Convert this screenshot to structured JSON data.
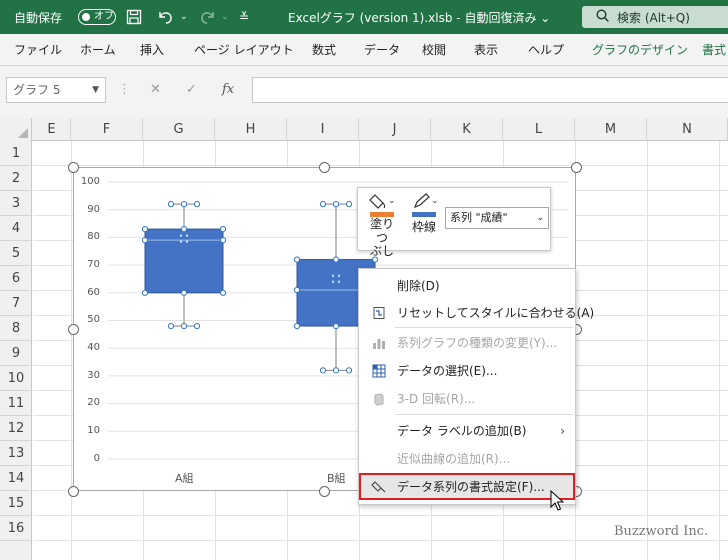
{
  "titlebar": {
    "autosave_label": "自動保存",
    "autosave_state": "オフ",
    "document_title": "Excelグラフ (version 1).xlsb  -  自動回復済み ⌄",
    "search_label": "検索 (Alt+Q)"
  },
  "ribbon": {
    "tabs": [
      "ファイル",
      "ホーム",
      "挿入",
      "ページ レイアウト",
      "数式",
      "データ",
      "校閲",
      "表示",
      "ヘルプ",
      "グラフのデザイン",
      "書式"
    ]
  },
  "formula_bar": {
    "name_box": "グラフ 5",
    "fx": "fx"
  },
  "grid": {
    "columns": [
      "E",
      "F",
      "G",
      "H",
      "I",
      "J",
      "K",
      "L",
      "M",
      "N"
    ],
    "rows": [
      "1",
      "2",
      "3",
      "4",
      "5",
      "6",
      "7",
      "8",
      "9",
      "10",
      "11",
      "12",
      "13",
      "14",
      "15",
      "16"
    ]
  },
  "chart_data": {
    "type": "box",
    "y_axis_ticks": [
      "100",
      "90",
      "80",
      "70",
      "60",
      "50",
      "40",
      "30",
      "20",
      "10",
      "0"
    ],
    "ylim": [
      0,
      100
    ],
    "categories": [
      "A組",
      "B組"
    ],
    "boxes": [
      {
        "category": "A組",
        "min": 48,
        "q1": 60,
        "median": 79,
        "q3": 83,
        "max": 92
      },
      {
        "category": "B組",
        "min": 32,
        "q1": 48,
        "median": 61,
        "q3": 72,
        "max": 92
      }
    ],
    "color": "#4472C4"
  },
  "mini_toolbar": {
    "fill_label_1": "塗りつ",
    "fill_label_2": "ぶし",
    "outline_label": "枠線",
    "series_select": "系列 \"成績\""
  },
  "context_menu": {
    "items": [
      {
        "label": "削除(D)",
        "icon": "delete-icon",
        "disabled": false
      },
      {
        "label": "リセットしてスタイルに合わせる(A)",
        "icon": "reset-style-icon",
        "disabled": false
      },
      {
        "label": "系列グラフの種類の変更(Y)...",
        "icon": "chart-type-icon",
        "disabled": true
      },
      {
        "label": "データの選択(E)...",
        "icon": "select-data-icon",
        "disabled": false
      },
      {
        "label": "3-D 回転(R)...",
        "icon": "rotate-3d-icon",
        "disabled": true
      },
      {
        "label": "データ ラベルの追加(B)",
        "icon": "",
        "disabled": false,
        "submenu": true
      },
      {
        "label": "近似曲線の追加(R)...",
        "icon": "",
        "disabled": true
      },
      {
        "label": "データ系列の書式設定(F)...",
        "icon": "format-series-icon",
        "disabled": false,
        "highlighted": true
      }
    ]
  },
  "watermark": "Buzzword Inc."
}
